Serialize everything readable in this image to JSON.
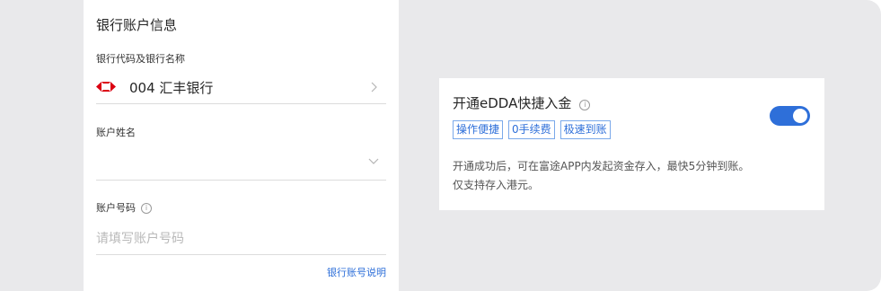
{
  "form": {
    "section_title": "银行账户信息",
    "bank": {
      "label": "银行代码及银行名称",
      "value": "004 汇丰银行",
      "logo_icon": "hsbc-logo-icon"
    },
    "account_name": {
      "label": "账户姓名",
      "value": ""
    },
    "account_number": {
      "label": "账户号码",
      "info_glyph": "i",
      "placeholder": "请填写账户号码"
    },
    "help_link": "银行账号说明"
  },
  "edda_card": {
    "title": "开通eDDA快捷入金",
    "info_glyph": "i",
    "tags": [
      "操作便捷",
      "0手续费",
      "极速到账"
    ],
    "toggle_on": true,
    "description_line1": "开通成功后，可在富途APP内发起资金存入，最快5分钟到账。",
    "description_line2": "仅支持存入港元。"
  },
  "colors": {
    "accent": "#2e6fd9",
    "background": "#e9e9eb",
    "hsbc_red": "#db0011"
  }
}
